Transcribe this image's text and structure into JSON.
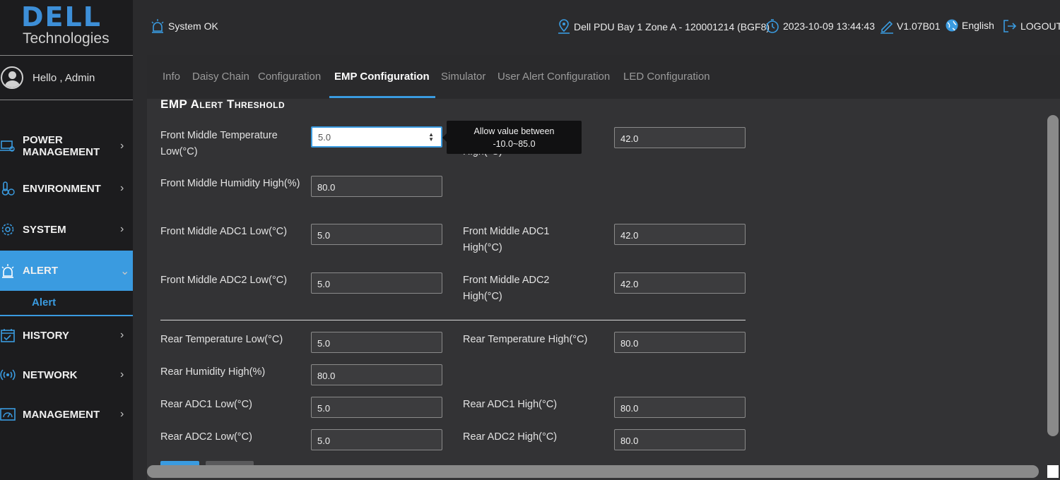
{
  "brand": {
    "dell": "DELL",
    "technologies": "Technologies"
  },
  "user": {
    "greeting": "Hello , Admin"
  },
  "sidebar": {
    "items": [
      {
        "label": "POWER MANAGEMENT",
        "icon": "laptop-icon"
      },
      {
        "label": "ENVIRONMENT",
        "icon": "thermometer-icon"
      },
      {
        "label": "SYSTEM",
        "icon": "gear-icon"
      },
      {
        "label": "ALERT",
        "icon": "alarm-light-icon",
        "active": true
      },
      {
        "label": "HISTORY",
        "icon": "calendar-check-icon"
      },
      {
        "label": "NETWORK",
        "icon": "broadcast-icon"
      },
      {
        "label": "MANAGEMENT",
        "icon": "dashboard-icon"
      }
    ],
    "sub_item": "Alert"
  },
  "header": {
    "status": "System OK",
    "location": "Dell PDU Bay 1 Zone A - 120001214 (BGF8)",
    "datetime": "2023-10-09 13:44:43",
    "version": "V1.07B01",
    "language": "English",
    "logout": "LOGOUT"
  },
  "tabs": [
    {
      "label": "Info"
    },
    {
      "label": "Daisy Chain"
    },
    {
      "label": "Configuration"
    },
    {
      "label": "EMP Configuration",
      "active": true
    },
    {
      "label": "Simulator"
    },
    {
      "label": "User Alert Configuration"
    },
    {
      "label": "LED Configuration"
    }
  ],
  "section_title": "EMP Alert Threshold",
  "fields": {
    "front_temp_low": {
      "label": "Front Middle Temperature Low(°C)",
      "value": "5.0"
    },
    "front_temp_high": {
      "label": "Front Middle Temperature High(°C)",
      "value": "42.0"
    },
    "front_humidity_high": {
      "label": "Front Middle Humidity High(%)",
      "value": "80.0"
    },
    "front_adc1_low": {
      "label": "Front Middle ADC1 Low(°C)",
      "value": "5.0"
    },
    "front_adc1_high": {
      "label": "Front Middle ADC1 High(°C)",
      "value": "42.0"
    },
    "front_adc2_low": {
      "label": "Front Middle ADC2 Low(°C)",
      "value": "5.0"
    },
    "front_adc2_high": {
      "label": "Front Middle ADC2 High(°C)",
      "value": "42.0"
    },
    "rear_temp_low": {
      "label": "Rear Temperature Low(°C)",
      "value": "5.0"
    },
    "rear_temp_high": {
      "label": "Rear Temperature High(°C)",
      "value": "80.0"
    },
    "rear_humidity_high": {
      "label": "Rear Humidity High(%)",
      "value": "80.0"
    },
    "rear_adc1_low": {
      "label": "Rear ADC1 Low(°C)",
      "value": "5.0"
    },
    "rear_adc1_high": {
      "label": "Rear ADC1 High(°C)",
      "value": "80.0"
    },
    "rear_adc2_low": {
      "label": "Rear ADC2 Low(°C)",
      "value": "5.0"
    },
    "rear_adc2_high": {
      "label": "Rear ADC2 High(°C)",
      "value": "80.0"
    }
  },
  "tooltip": {
    "line1": "Allow value between",
    "line2": "-10.0~85.0"
  },
  "colors": {
    "accent": "#3a9be0",
    "sidebar_bg": "#1c1c1e",
    "panel_bg": "#333335"
  }
}
